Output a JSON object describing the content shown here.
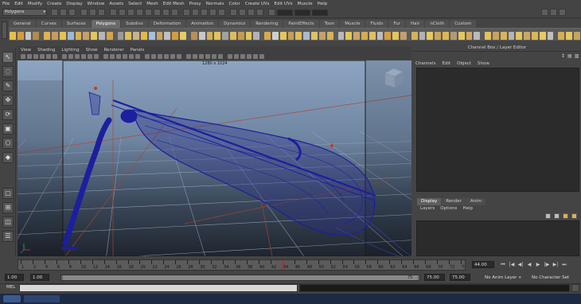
{
  "menubar": [
    "File",
    "Edit",
    "Modify",
    "Create",
    "Display",
    "Window",
    "Assets",
    "Select",
    "Mesh",
    "Edit Mesh",
    "Proxy",
    "Normals",
    "Color",
    "Create UVs",
    "Edit UVs",
    "Muscle",
    "Help"
  ],
  "statusline": {
    "mode": "Polygons"
  },
  "shelf": {
    "tabs": [
      "General",
      "Curves",
      "Surfaces",
      "Polygons",
      "Subdivs",
      "Deformation",
      "Animation",
      "Dynamics",
      "Rendering",
      "PaintEffects",
      "Toon",
      "Muscle",
      "Fluids",
      "Fur",
      "Hair",
      "nCloth",
      "Custom"
    ],
    "active_tab": "Polygons",
    "icon_colors": [
      "#e3c14a",
      "#d89b3a",
      "#c7c7c7",
      "#b28a4b",
      "#e0b24f",
      "#c69b64",
      "#e4c252",
      "#9fb7d5",
      "#d8b05c",
      "#c9a06a",
      "#e0c85b",
      "#b7b7b7",
      "#d5a44c",
      "#9a9a9a",
      "#dcbf5a",
      "#c9b489",
      "#e1b94e",
      "#a8c0dc",
      "#cfa55d",
      "#bfbfbf",
      "#d69c3f",
      "#e6cd64",
      "#b9905a",
      "#c8c8c8",
      "#d4af55",
      "#e3c35c",
      "#a1a1a1",
      "#dcbc60",
      "#c59a53",
      "#e2c65f",
      "#b3b3b3",
      "#d7a94e",
      "#cfcfcf",
      "#e4c75e",
      "#c79e58",
      "#dfbc57",
      "#aeb9c8",
      "#e0c164",
      "#c3a06c",
      "#d7b15a",
      "#b9b9b9",
      "#e2c65a",
      "#cba567",
      "#d3ad52",
      "#e0be61",
      "#bcbcbc",
      "#d89e44",
      "#e2c560",
      "#c1a070",
      "#d5b259",
      "#b2b2b2",
      "#e4c95f",
      "#c9a45c",
      "#dcb853",
      "#ad9b7c",
      "#e3c860",
      "#cfa960",
      "#bababa",
      "#e2c35d",
      "#c8a261",
      "#d8b45a",
      "#b5b5b5",
      "#e1c65e",
      "#caa862",
      "#dab755",
      "#e5ca62",
      "#bfbfbf",
      "#d6ad56",
      "#e3c75f",
      "#c6a35f"
    ]
  },
  "viewport": {
    "menu": [
      "View",
      "Shading",
      "Lighting",
      "Show",
      "Renderer",
      "Panels"
    ],
    "resolution": "1280 x 1024"
  },
  "channel_box": {
    "title": "Channel Box / Layer Editor",
    "menu": [
      "Channels",
      "Edit",
      "Object",
      "Show"
    ]
  },
  "layer_editor": {
    "tabs": [
      "Display",
      "Render",
      "Anim"
    ],
    "active_tab": "Display",
    "menu": [
      "Layers",
      "Options",
      "Help"
    ]
  },
  "timeline": {
    "ticks": [
      "1",
      "2",
      "4",
      "6",
      "8",
      "10",
      "12",
      "14",
      "16",
      "18",
      "20",
      "22",
      "24",
      "26",
      "28",
      "30",
      "32",
      "34",
      "36",
      "38",
      "40",
      "42",
      "44",
      "46",
      "48",
      "50",
      "52",
      "54",
      "56",
      "58",
      "60",
      "62",
      "64",
      "66",
      "68",
      "70",
      "72",
      "74"
    ],
    "current_frame": "44.00"
  },
  "range": {
    "start": "1.00",
    "start2": "1.00",
    "slider_end": "75",
    "end": "75.00",
    "end2": "75.00",
    "anim_layer": "No Anim Layer",
    "char_set": "No Character Set"
  },
  "cmdline": {
    "label": "MEL"
  },
  "colors": {
    "wire": "#1c1f9e",
    "grid": "#95a6bf",
    "axis": "#b0442f"
  }
}
